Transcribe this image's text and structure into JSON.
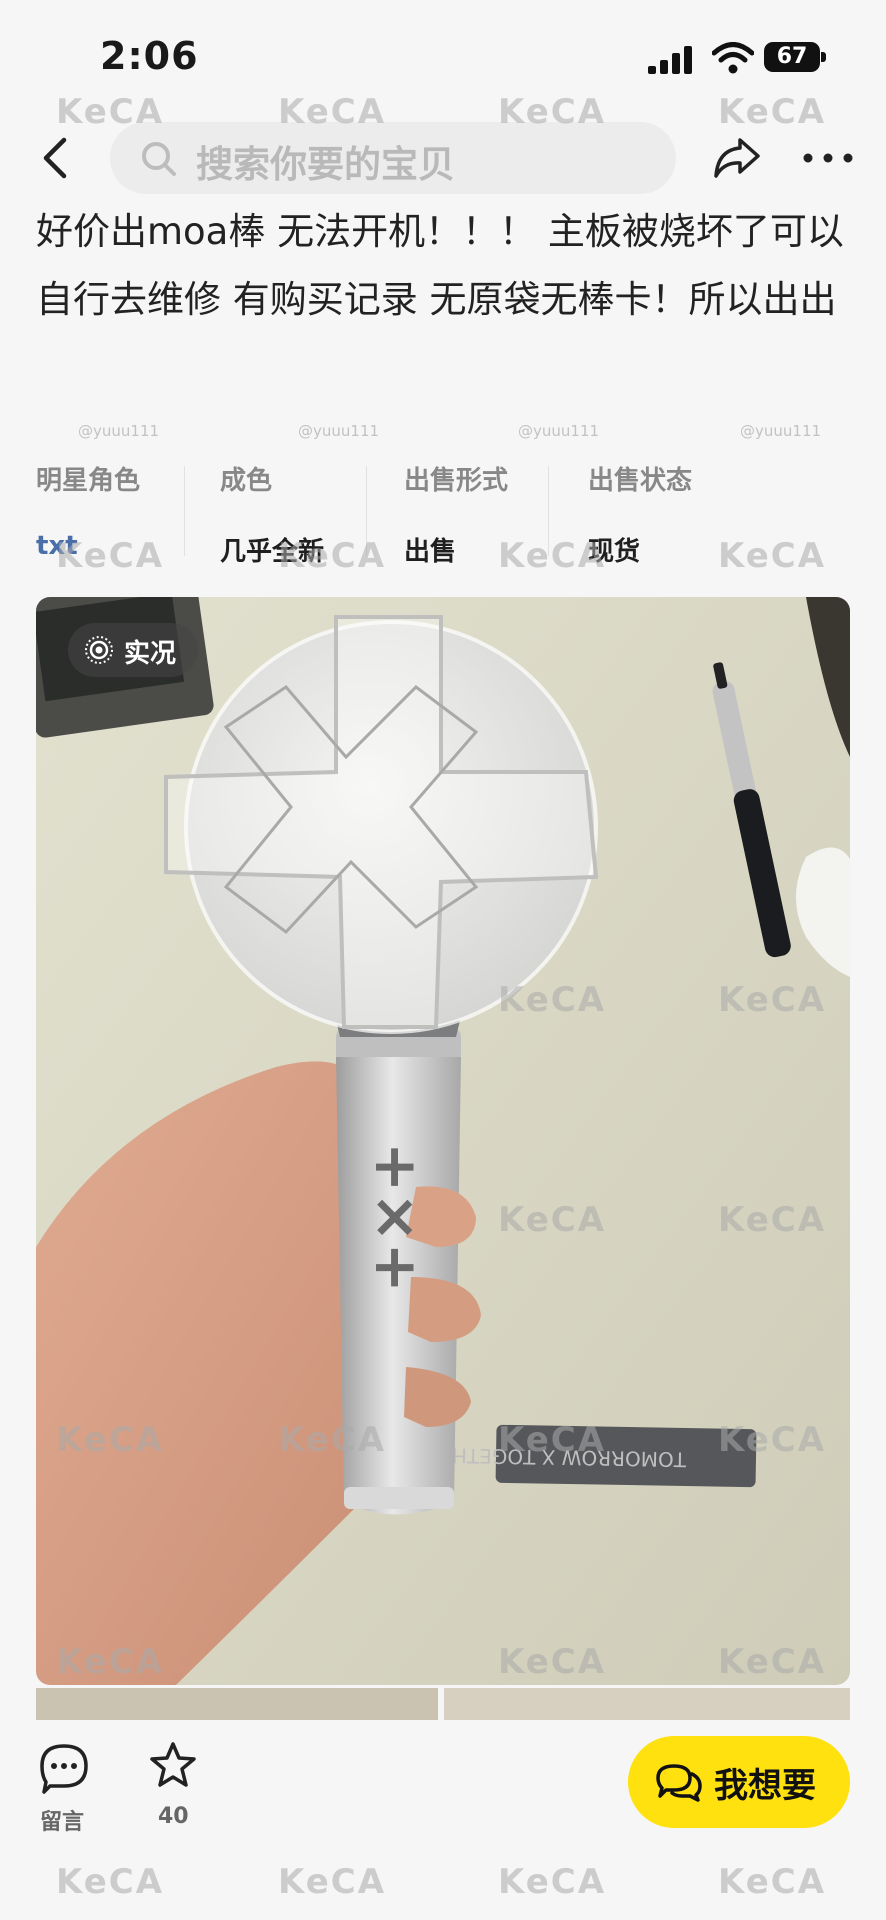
{
  "status_bar": {
    "time": "2:06",
    "battery": "67"
  },
  "nav": {
    "search_placeholder": "搜索你要的宝贝"
  },
  "listing": {
    "title": "好价出moa棒 无法开机！！！ 主板被烧坏了可以自行去维修 有购买记录 无原袋无棒卡！所以出出",
    "attributes": [
      {
        "label": "明星角色",
        "value": "txt"
      },
      {
        "label": "成色",
        "value": "几乎全新"
      },
      {
        "label": "出售形式",
        "value": "出售"
      },
      {
        "label": "出售状态",
        "value": "现货"
      }
    ],
    "photo": {
      "badge": "实况",
      "stick_logo_text": "+×+",
      "strap_text": "TOMORROW X TOGETHER"
    }
  },
  "bottom_bar": {
    "comment_label": "留言",
    "favorite_count": "40",
    "want_label": "我想要"
  },
  "watermark": {
    "brand": "KeCA",
    "user": "@yuuu111"
  },
  "colors": {
    "accent_yellow": "#ffe10f",
    "link_blue": "#4a6ea8",
    "background": "#f6f6f6"
  }
}
